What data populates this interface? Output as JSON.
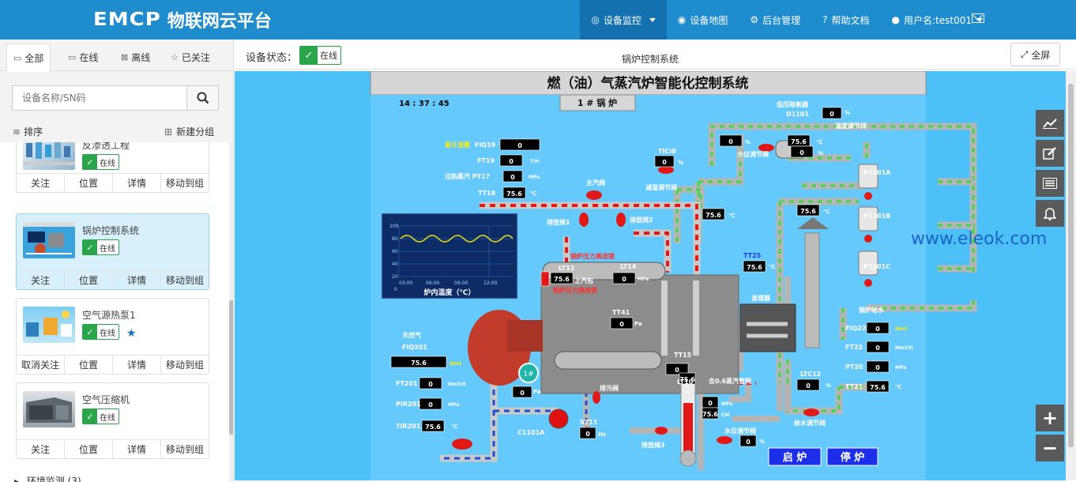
{
  "header": {
    "logo_en": "EMCP",
    "logo_cn": "物联网云平台",
    "nav": [
      {
        "label": "设备监控",
        "icon": "monitor-icon"
      },
      {
        "label": "设备地图",
        "icon": "globe-icon"
      },
      {
        "label": "后台管理",
        "icon": "gears-icon"
      },
      {
        "label": "帮助文档",
        "icon": "help-icon"
      },
      {
        "label": "用户名:test001",
        "icon": "user-icon"
      }
    ]
  },
  "sidebar": {
    "tabs": [
      {
        "label": "全部",
        "icon": "desktop-icon"
      },
      {
        "label": "在线",
        "icon": "desktop-online-icon"
      },
      {
        "label": "离线",
        "icon": "offline-icon"
      },
      {
        "label": "已关注",
        "icon": "star-icon"
      }
    ],
    "search_placeholder": "设备名称/SN码",
    "sort_label": "排序",
    "new_group_label": "新建分组",
    "devices": [
      {
        "name": "反渗透工程",
        "status": "在线",
        "actions": [
          "关注",
          "位置",
          "详情",
          "移动到组"
        ]
      },
      {
        "name": "锅炉控制系统",
        "status": "在线",
        "actions": [
          "关注",
          "位置",
          "详情",
          "移动到组"
        ]
      },
      {
        "name": "空气源热泵1",
        "status": "在线",
        "actions": [
          "取消关注",
          "位置",
          "详情",
          "移动到组"
        ]
      },
      {
        "name": "空气压缩机",
        "status": "在线",
        "actions": [
          "关注",
          "位置",
          "详情",
          "移动到组"
        ]
      }
    ],
    "group_row": "环境监测 (3)"
  },
  "main": {
    "status_label": "设备状态：",
    "status_value": "在线",
    "title": "锅炉控制系统",
    "fullscreen_label": "全屏"
  },
  "scada": {
    "title": "燃（油）气蒸汽炉智能化控制系统",
    "time": "14 : 37 : 45",
    "boiler_no": "1 # 锅 炉",
    "labels": {
      "fiq19": "FIQ19",
      "fiq19_label": "累计流量",
      "ft19": "FT19",
      "ft19_unit": "T/H",
      "pt17": "过热蒸汽 PT17",
      "pt17_unit": "MPa",
      "tt18": "TT18",
      "tt18_unit": "℃",
      "main_valve": "主汽阀",
      "drain1": "排放阀1",
      "drain2": "排放阀2",
      "tic18": "TICI8",
      "desuper_valve": "减温调节阀",
      "low_desuper": "低压除氧器",
      "d1101": "D1101",
      "temp_valve": "温度调节阀",
      "level_valve": "水位调节阀",
      "p1101a": "P1101A",
      "p1101b": "P1101B",
      "p1101c": "P1101C",
      "lt12": "LT12",
      "lt14": "LT14",
      "upper_drum": "上汽包",
      "boiler_pressure": "锅炉压力高连锁",
      "tt41": "TT41",
      "tt41_unit": "Pa",
      "tt25": "TT25",
      "economizer": "省煤器",
      "boiler_feed": "锅炉给水",
      "fiq22": "FIQ22",
      "ft22": "FT22",
      "pt20": "PT20",
      "tt21": "TT21",
      "nm3": "Nm3",
      "nm3h": "Nm3/H",
      "mpa": "MPa",
      "degc": "℃",
      "pct": "%",
      "natural_gas": "天然气",
      "fiq201": "FIQ201",
      "ft201": "FT201",
      "pir201": "PIR201",
      "tir201": "TIR201",
      "one_hash": "1#",
      "drain_valve": "排污阀",
      "c1101a": "C1101A",
      "st11": "ST11",
      "hz": "Hz",
      "tt15": "TT15",
      "lt10": "LT10",
      "steam_valve": "去0.6蒸汽管网",
      "ltc12": "LTC12",
      "feedwater_valve": "给水调节阀",
      "drain3": "排放阀3",
      "level_valve2": "水位调节阀",
      "start": "启 炉",
      "stop": "停 炉",
      "furnace_temp": "炉内温度（℃）",
      "cm": "CM"
    },
    "values": {
      "fiq19": "0",
      "ft19": "0",
      "pt17": "0",
      "tt18": "75.6",
      "tic18": "0",
      "desuper_pct": "0",
      "d1101_pct": "0",
      "d1101_temp": "75.6",
      "d1101_val": "0",
      "pipe_temp1": "75.6",
      "pipe_temp2": "75.6",
      "lt12": "75.6",
      "lt14": "0",
      "tt41": "0",
      "tt25": "75.6",
      "fiq22": "0",
      "ft22": "0",
      "pt20": "0",
      "tt21": "75.6",
      "fiq201": "75.6",
      "ft201": "0",
      "pir201": "0",
      "tir201": "75.6",
      "gas_pa": "0",
      "st11": "0",
      "tt15": "0",
      "lt10": "75.6",
      "tt15_mpa": "0",
      "tt15_cm": "75.6",
      "ltc12": "0",
      "level2": "0",
      "lt12_small": "75.6"
    },
    "chart": {
      "yticks": [
        "100",
        "80",
        "60",
        "40",
        "20",
        "0"
      ],
      "xticks": [
        "03:00",
        "06:00",
        "09:00",
        "12:00"
      ]
    }
  },
  "watermark": "www.eleok.com",
  "colors": {
    "header": "#1f8ccd",
    "scada_bg": "#4cc0f7",
    "online": "#2aa54a"
  }
}
